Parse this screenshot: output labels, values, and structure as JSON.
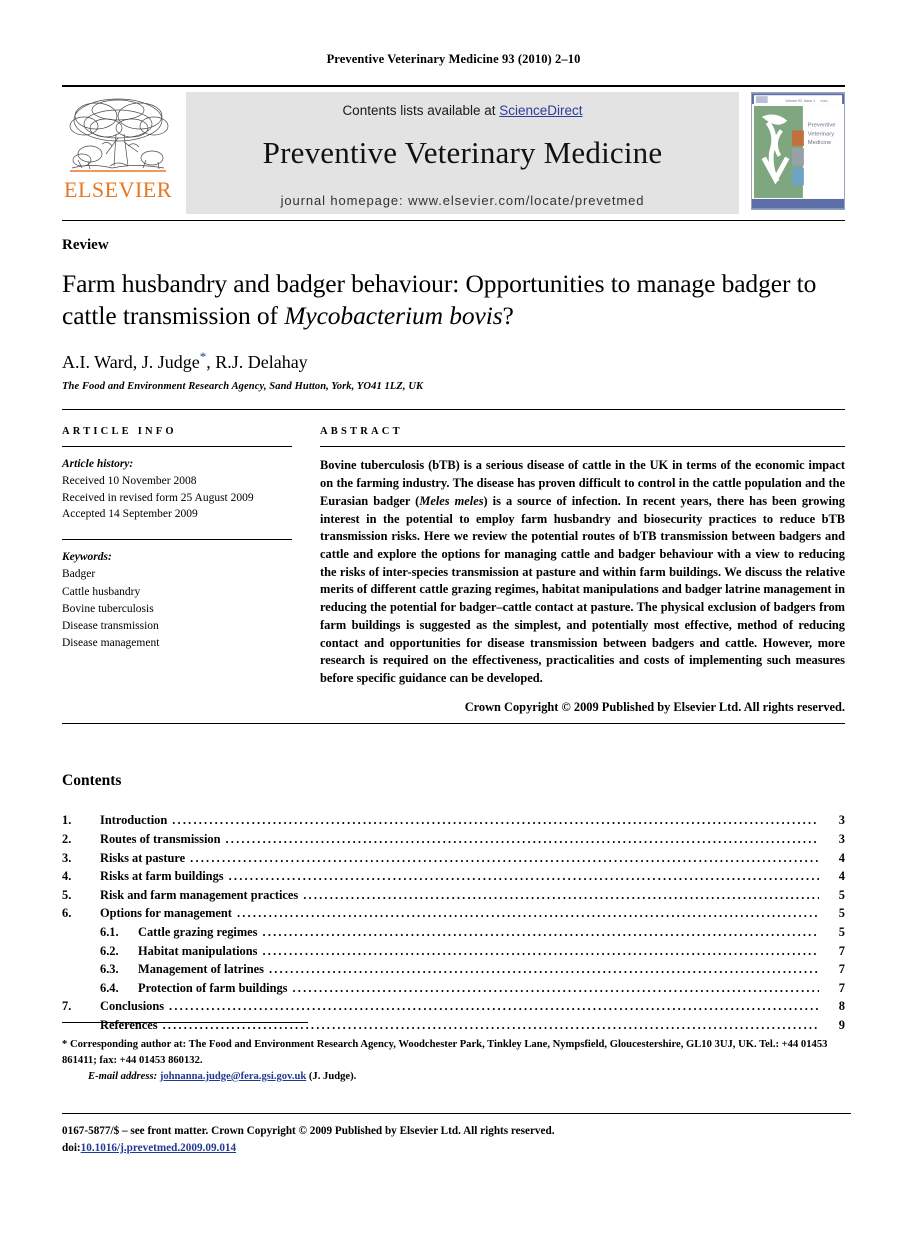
{
  "running_head": "Preventive Veterinary Medicine 93 (2010) 2–10",
  "masthead": {
    "publisher_wordmark": "ELSEVIER",
    "contents_prefix": "Contents lists available at ",
    "contents_link": "ScienceDirect",
    "journal_title": "Preventive Veterinary Medicine",
    "homepage": "journal homepage: www.elsevier.com/locate/prevetmed",
    "cover_title_line1": "Preventive",
    "cover_title_line2": "Veterinary",
    "cover_title_line3": "Medicine",
    "link_color": "#2b3c9b",
    "banner_bg": "#e3e3e3",
    "elsevier_orange": "#E87722"
  },
  "article": {
    "type": "Review",
    "title_part1": "Farm husbandry and badger behaviour: Opportunities to manage badger to cattle transmission of ",
    "title_italic": "Mycobacterium bovis",
    "title_part2": "?",
    "authors": "A.I. Ward, J. Judge",
    "authors_tail": ", R.J. Delahay",
    "corresponding_marker": "*",
    "affiliation": "The Food and Environment Research Agency, Sand Hutton, York, YO41 1LZ, UK"
  },
  "article_info": {
    "heading": "ARTICLE INFO",
    "history_label": "Article history:",
    "history": [
      "Received 10 November 2008",
      "Received in revised form 25 August 2009",
      "Accepted 14 September 2009"
    ],
    "keywords_label": "Keywords:",
    "keywords": [
      "Badger",
      "Cattle husbandry",
      "Bovine tuberculosis",
      "Disease transmission",
      "Disease management"
    ]
  },
  "abstract": {
    "heading": "ABSTRACT",
    "text_part1": "Bovine tuberculosis (bTB) is a serious disease of cattle in the UK in terms of the economic impact on the farming industry. The disease has proven difficult to control in the cattle population and the Eurasian badger (",
    "species_italic": "Meles meles",
    "text_part2": ") is a source of infection. In recent years, there has been growing interest in the potential to employ farm husbandry and biosecurity practices to reduce bTB transmission risks. Here we review the potential routes of bTB transmission between badgers and cattle and explore the options for managing cattle and badger behaviour with a view to reducing the risks of inter-species transmission at pasture and within farm buildings. We discuss the relative merits of different cattle grazing regimes, habitat manipulations and badger latrine management in reducing the potential for badger–cattle contact at pasture. The physical exclusion of badgers from farm buildings is suggested as the simplest, and potentially most effective, method of reducing contact and opportunities for disease transmission between badgers and cattle. However, more research is required on the effectiveness, practicalities and costs of implementing such measures before specific guidance can be developed.",
    "copyright": "Crown Copyright © 2009 Published by Elsevier Ltd. All rights reserved."
  },
  "contents": {
    "heading": "Contents",
    "entries": [
      {
        "num": "1.",
        "label": "Introduction",
        "page": "3",
        "level": 1
      },
      {
        "num": "2.",
        "label": "Routes of transmission",
        "page": "3",
        "level": 1
      },
      {
        "num": "3.",
        "label": "Risks at pasture",
        "page": "4",
        "level": 1
      },
      {
        "num": "4.",
        "label": "Risks at farm buildings",
        "page": "4",
        "level": 1
      },
      {
        "num": "5.",
        "label": "Risk and farm management practices",
        "page": "5",
        "level": 1
      },
      {
        "num": "6.",
        "label": "Options for management",
        "page": "5",
        "level": 1
      },
      {
        "num": "6.1.",
        "label": "Cattle grazing regimes",
        "page": "5",
        "level": 2
      },
      {
        "num": "6.2.",
        "label": "Habitat manipulations",
        "page": "7",
        "level": 2
      },
      {
        "num": "6.3.",
        "label": "Management of latrines",
        "page": "7",
        "level": 2
      },
      {
        "num": "6.4.",
        "label": "Protection of farm buildings",
        "page": "7",
        "level": 2
      },
      {
        "num": "7.",
        "label": "Conclusions",
        "page": "8",
        "level": 1
      },
      {
        "num": "",
        "label": "References",
        "page": "9",
        "level": 1
      }
    ]
  },
  "footnotes": {
    "corresponding_star": "*",
    "corresponding_text": "Corresponding author at: The Food and Environment Research Agency, Woodchester Park, Tinkley Lane, Nympsfield, Gloucestershire, GL10 3UJ, UK. Tel.: +44 01453 861411; fax: +44 01453 860132.",
    "email_label": "E-mail address:",
    "email": "johnanna.judge@fera.gsi.gov.uk",
    "email_owner": "(J. Judge)."
  },
  "footer": {
    "issn_line": "0167-5877/$ – see front matter. Crown Copyright © 2009 Published by Elsevier Ltd. All rights reserved.",
    "doi_prefix": "doi:",
    "doi": "10.1016/j.prevetmed.2009.09.014"
  }
}
